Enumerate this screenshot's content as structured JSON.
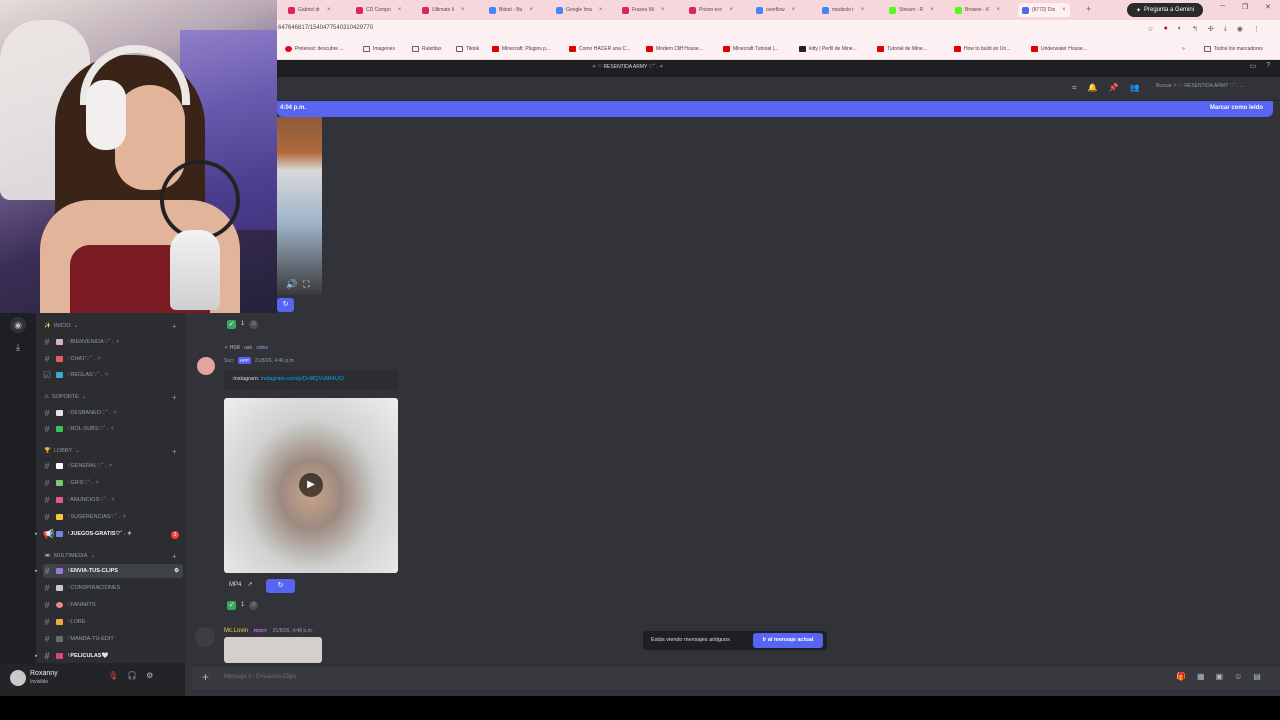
{
  "browser": {
    "tabs": [
      {
        "label": "Gabriel dr",
        "color": "#e0245e"
      },
      {
        "label": "CD Compo",
        "color": "#e0245e"
      },
      {
        "label": "Ultimate li",
        "color": "#e0245e"
      },
      {
        "label": "Bidari - Bu",
        "color": "#4285f4"
      },
      {
        "label": "Google Ima",
        "color": "#4285f4"
      },
      {
        "label": "Frases Mi",
        "color": "#e0245e"
      },
      {
        "label": "Prison esc",
        "color": "#e0245e"
      },
      {
        "label": "overflow",
        "color": "#4285f4"
      },
      {
        "label": "modsolo t",
        "color": "#4285f4"
      },
      {
        "label": "Stream - R",
        "color": "#53fc18"
      },
      {
        "label": "Browse - K",
        "color": "#53fc18"
      },
      {
        "label": "(8772) Dis",
        "color": "#5865f2"
      }
    ],
    "gemini_label": "Pregunta a Gemini",
    "url": "647646817/1540477540310429770",
    "bookmarks": [
      {
        "label": "Pinterest: descubre ...",
        "color": "#e60023"
      },
      {
        "label": "Imagenes",
        "color": "#6b5a60"
      },
      {
        "label": "Ruletitas",
        "color": "#6b5a60"
      },
      {
        "label": "Tiktok",
        "color": "#6b5a60"
      },
      {
        "label": "Minecraft: Plugins p...",
        "color": "#e00000"
      },
      {
        "label": "Como HACER una C...",
        "color": "#e00000"
      },
      {
        "label": "Modern Cliff House...",
        "color": "#e00000"
      },
      {
        "label": "Minecraft Tutorial |...",
        "color": "#e00000"
      },
      {
        "label": "kitty | Perfil de Mine...",
        "color": "#222222"
      },
      {
        "label": "Tutorial de Mine...",
        "color": "#e00000"
      },
      {
        "label": "How to build an Un...",
        "color": "#e00000"
      },
      {
        "label": "Underwater House...",
        "color": "#e00000"
      }
    ],
    "all_bookmarks": "Todos los marcadores"
  },
  "discord": {
    "server_title": "✧ ♡ RESENTIDA ARMY ♡˚ ˖ ✧",
    "search_placeholder": "Buscar ✧ ♡ RESENTIDA ARMY ♡˚ ˖ ...",
    "new_messages_time": "4:04 p.m.",
    "mark_read": "Marcar como leído",
    "categories": {
      "inicio": "INICIO",
      "soporte": "SOPORTE",
      "lobby": "LOBBY",
      "multimedia": "MULTIMEDIA"
    },
    "channels": {
      "bienvenida": "ᵎ BIENVENIDA♡˚ ˖ ✧",
      "chat": "ᵎ CHAT♡˚ ˖ ✧",
      "reglas": "ᵎ REGLAS♡˚ ˖ ✧",
      "desbaneo": "ᵎ DESBANEO♡˚ ˖ ✧",
      "rol_subs": "ᵎ ROL-SUBS♡˚ ˖ ✧",
      "general": "ᵎ GENERAL♡˚ ˖ ✧",
      "gifs": "ᵎ GIFS♡˚ ˖ ✧",
      "anuncios": "ᵎ ANUNCIOS♡˚ ˖ ✧",
      "sugerencias": "ᵎ SUGERENCIAS♡˚ ˖ ✧",
      "juegos_gratis": "ᵎ JUEGOS-GRATIS♡˚ ˖ ✧",
      "envia_tus_clips": "ᵎ ENVIA-TUS-CLIPS",
      "conspiraciones": "ᵎ CONSPIRACIONES",
      "fanarts": "ᵎ FANARTS",
      "lore": "ᵎ LORE",
      "manda_tu_edit": "ᵎ MANDA-TU-EDIT",
      "peliculas": "ᵎ PELICULAS🤍"
    },
    "juegos_badge": "3",
    "user": {
      "name": "Roxanny",
      "status": "Invisible"
    },
    "messages": {
      "reaction_count_1": "1",
      "reply_prefix": "✧ HSR",
      "reply_used": "usó",
      "reply_cmd": "video",
      "author2": "Soci",
      "app_tag": "APP",
      "time2": "21/8/26, 4:46 p.m.",
      "embed_prefix": ":instagram:",
      "embed_link": "instagram.com/p/DcMQVv5B4UC/",
      "mp4_label": "MP4",
      "reaction_count_2": "1",
      "author3": "Mc.Lovin",
      "author3_tag": "ROXY",
      "time3": "21/8/26, 4:48 p.m."
    },
    "old_messages_text": "Estás viendo mensajes antiguos",
    "jump_present": "Ir al mensaje actual",
    "composer_placeholder": "Mensaje #  ᵎ Envia-tus-Clips"
  }
}
